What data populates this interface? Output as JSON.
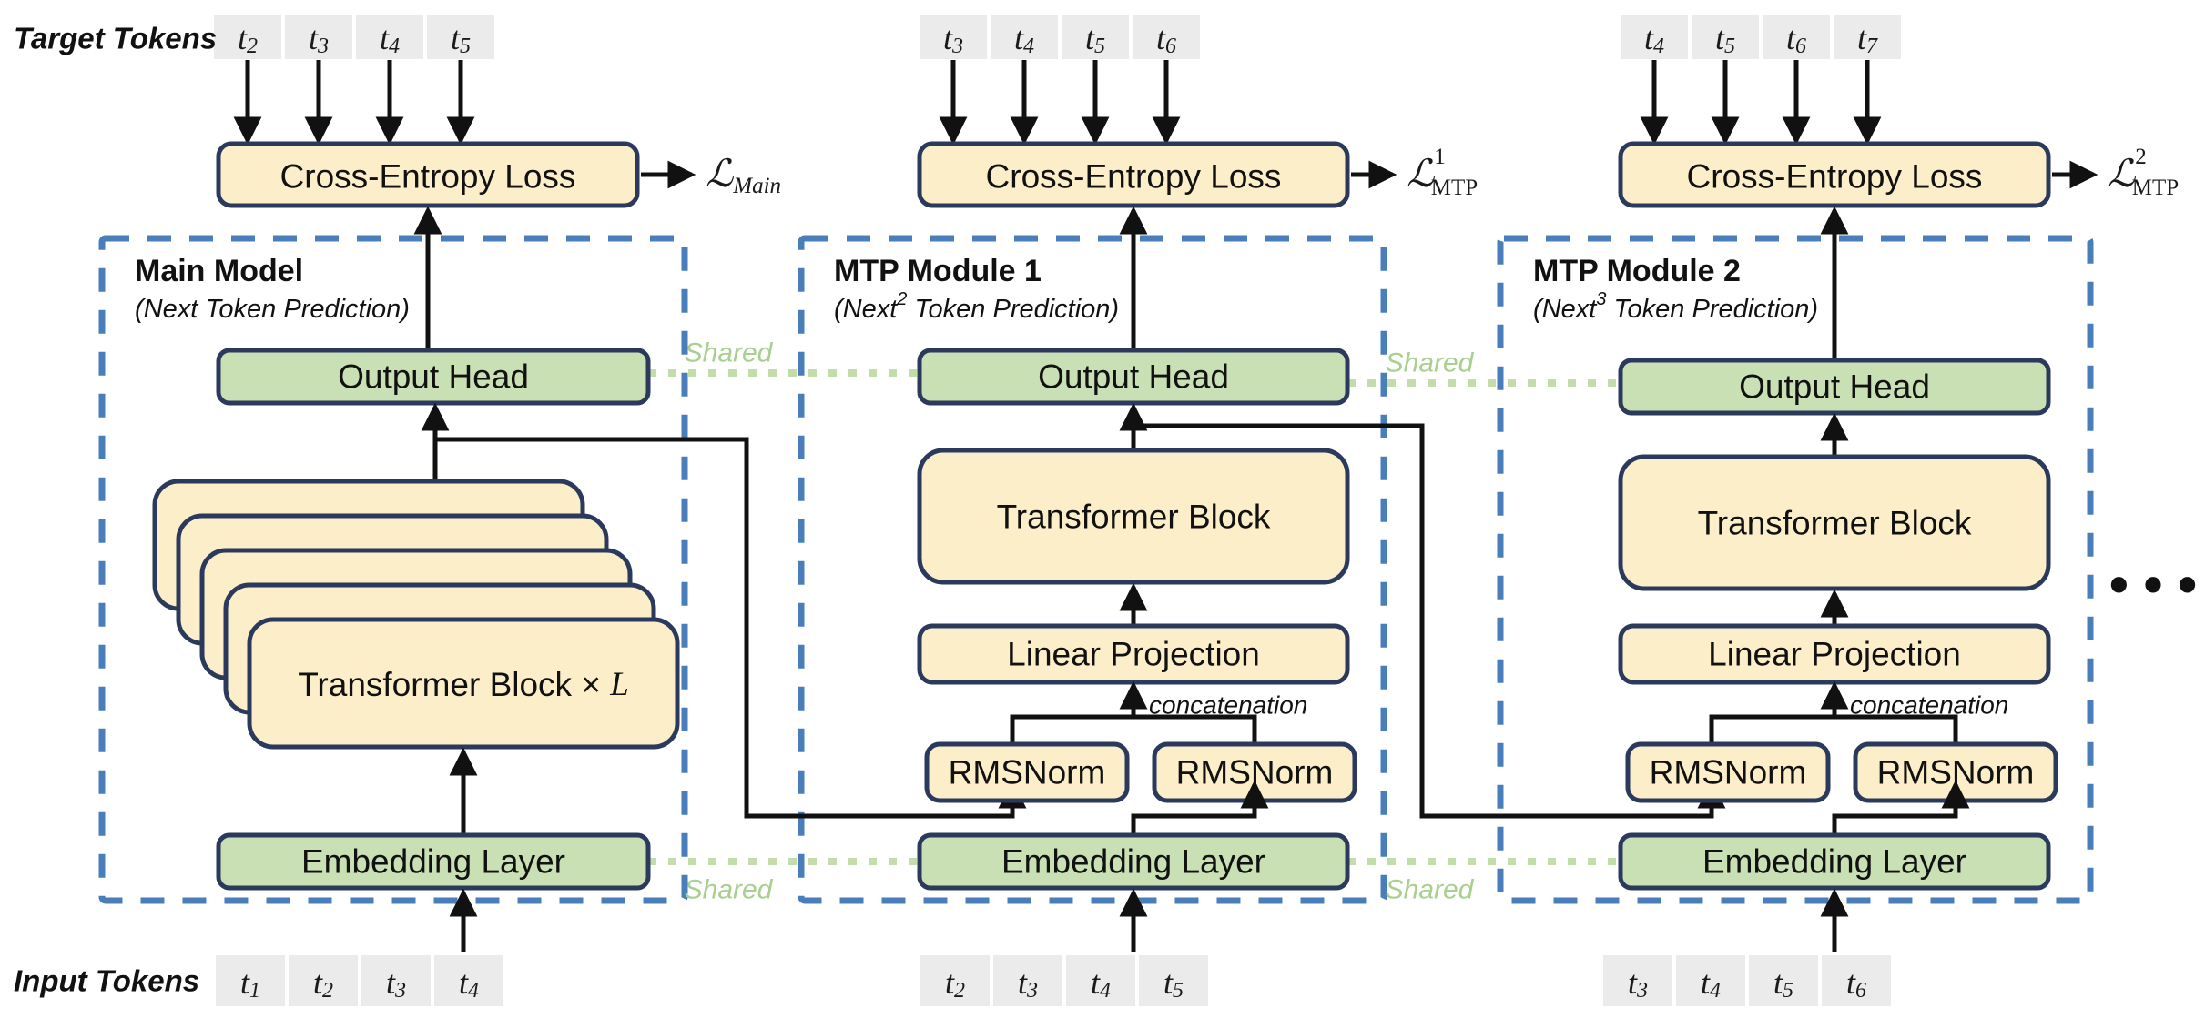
{
  "figure": {
    "title": "Multi-Token Prediction (MTP) training objective diagram",
    "row_labels": {
      "target_tokens": "Target Tokens",
      "input_tokens": "Input Tokens"
    },
    "ellipsis": "• • •",
    "shared_label": "Shared",
    "concatenation_label": "concatenation",
    "colors": {
      "yellow_fill": "#fbeec8",
      "green_fill": "#c9dfb4",
      "box_stroke": "#2b3a5c",
      "dashed_border": "#4a7ebb",
      "token_fill": "#ebebeb",
      "shared_line": "#c3ddaa",
      "arrow": "#111111"
    }
  },
  "columns": [
    {
      "id": "main-model",
      "title": "Main Model",
      "subtitle_prefix": "(Next",
      "subtitle_sup": "",
      "subtitle_suffix": " Token Prediction)",
      "loss": {
        "symbol": "ℒ",
        "sup": "",
        "sub": "Main"
      },
      "loss_box": "Cross-Entropy Loss",
      "target_tokens": [
        {
          "base": "t",
          "sub": "2"
        },
        {
          "base": "t",
          "sub": "3"
        },
        {
          "base": "t",
          "sub": "4"
        },
        {
          "base": "t",
          "sub": "5"
        }
      ],
      "input_tokens": [
        {
          "base": "t",
          "sub": "1"
        },
        {
          "base": "t",
          "sub": "2"
        },
        {
          "base": "t",
          "sub": "3"
        },
        {
          "base": "t",
          "sub": "4"
        }
      ],
      "blocks": {
        "output_head": "Output Head",
        "transformer": "Transformer Block × L",
        "transformer_main": "Transformer Block",
        "transformer_count_symbol": "L",
        "embedding": "Embedding Layer"
      }
    },
    {
      "id": "mtp-module-1",
      "title": "MTP Module 1",
      "subtitle_prefix": "(Next",
      "subtitle_sup": "2",
      "subtitle_suffix": " Token Prediction)",
      "loss": {
        "symbol": "ℒ",
        "sup": "1",
        "sub": "MTP"
      },
      "loss_box": "Cross-Entropy Loss",
      "target_tokens": [
        {
          "base": "t",
          "sub": "3"
        },
        {
          "base": "t",
          "sub": "4"
        },
        {
          "base": "t",
          "sub": "5"
        },
        {
          "base": "t",
          "sub": "6"
        }
      ],
      "input_tokens": [
        {
          "base": "t",
          "sub": "2"
        },
        {
          "base": "t",
          "sub": "3"
        },
        {
          "base": "t",
          "sub": "4"
        },
        {
          "base": "t",
          "sub": "5"
        }
      ],
      "blocks": {
        "output_head": "Output Head",
        "transformer": "Transformer Block",
        "linear_projection": "Linear Projection",
        "rmsnorm_left": "RMSNorm",
        "rmsnorm_right": "RMSNorm",
        "embedding": "Embedding Layer"
      }
    },
    {
      "id": "mtp-module-2",
      "title": "MTP Module 2",
      "subtitle_prefix": "(Next",
      "subtitle_sup": "3",
      "subtitle_suffix": " Token Prediction)",
      "loss": {
        "symbol": "ℒ",
        "sup": "2",
        "sub": "MTP"
      },
      "loss_box": "Cross-Entropy Loss",
      "target_tokens": [
        {
          "base": "t",
          "sub": "4"
        },
        {
          "base": "t",
          "sub": "5"
        },
        {
          "base": "t",
          "sub": "6"
        },
        {
          "base": "t",
          "sub": "7"
        }
      ],
      "input_tokens": [
        {
          "base": "t",
          "sub": "3"
        },
        {
          "base": "t",
          "sub": "4"
        },
        {
          "base": "t",
          "sub": "5"
        },
        {
          "base": "t",
          "sub": "6"
        }
      ],
      "blocks": {
        "output_head": "Output Head",
        "transformer": "Transformer Block",
        "linear_projection": "Linear Projection",
        "rmsnorm_left": "RMSNorm",
        "rmsnorm_right": "RMSNorm",
        "embedding": "Embedding Layer"
      }
    }
  ],
  "shared_connections": [
    {
      "label": "Shared",
      "from": "main-model.output_head",
      "to": "mtp-module-1.output_head"
    },
    {
      "label": "Shared",
      "from": "mtp-module-1.output_head",
      "to": "mtp-module-2.output_head"
    },
    {
      "label": "Shared",
      "from": "main-model.embedding",
      "to": "mtp-module-1.embedding"
    },
    {
      "label": "Shared",
      "from": "mtp-module-1.embedding",
      "to": "mtp-module-2.embedding"
    }
  ]
}
